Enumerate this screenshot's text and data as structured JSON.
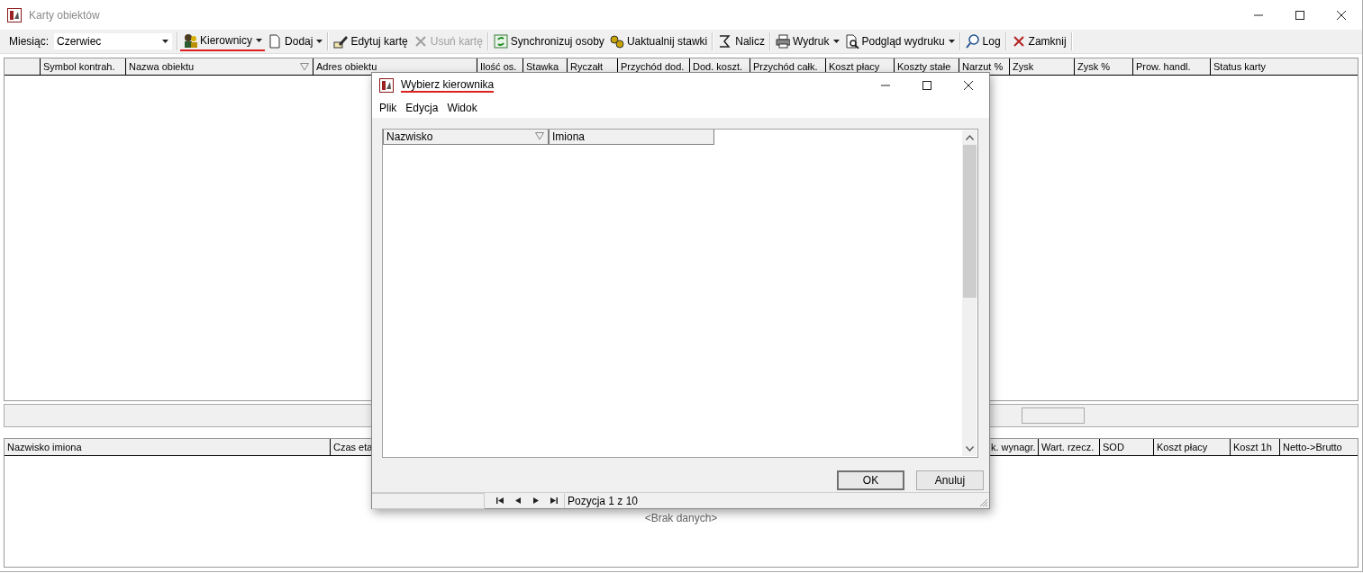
{
  "window": {
    "title": "Karty obiektów"
  },
  "toolbar": {
    "month_label": "Miesiąc:",
    "month_value": "Czerwiec",
    "buttons": [
      {
        "label": "Kierownicy",
        "dropdown": true,
        "disabled": false,
        "highlighted": true
      },
      {
        "label": "Dodaj",
        "dropdown": true,
        "disabled": false,
        "highlighted": false
      },
      {
        "label": "Edytuj kartę",
        "dropdown": false,
        "disabled": false,
        "highlighted": false
      },
      {
        "label": "Usuń kartę",
        "dropdown": false,
        "disabled": true,
        "highlighted": false
      },
      {
        "label": "Synchronizuj osoby",
        "dropdown": false,
        "disabled": false,
        "highlighted": false
      },
      {
        "label": "Uaktualnij stawki",
        "dropdown": false,
        "disabled": false,
        "highlighted": false
      },
      {
        "label": "Nalicz",
        "dropdown": false,
        "disabled": false,
        "highlighted": false
      },
      {
        "label": "Wydruk",
        "dropdown": true,
        "disabled": false,
        "highlighted": false
      },
      {
        "label": "Podgląd wydruku",
        "dropdown": true,
        "disabled": false,
        "highlighted": false
      },
      {
        "label": "Log",
        "dropdown": false,
        "disabled": false,
        "highlighted": false
      },
      {
        "label": "Zamknij",
        "dropdown": false,
        "disabled": false,
        "highlighted": false
      }
    ]
  },
  "objects_table": {
    "columns": [
      {
        "sorted": false
      },
      {
        "label": "Symbol kontrah.",
        "sorted": false
      },
      {
        "label": "Nazwa obiektu",
        "sorted": true
      },
      {
        "label": "Adres obiektu",
        "sorted": false
      },
      {
        "label": "Ilość os.",
        "sorted": false
      },
      {
        "label": "Stawka",
        "sorted": false
      },
      {
        "label": "Ryczałt",
        "sorted": false
      },
      {
        "label": "Przychód dod.",
        "sorted": false
      },
      {
        "label": "Dod. koszt.",
        "sorted": false
      },
      {
        "label": "Przychód całk.",
        "sorted": false
      },
      {
        "label": "Koszt płacy",
        "sorted": false
      },
      {
        "label": "Koszty stałe",
        "sorted": false
      },
      {
        "label": "Narzut %",
        "sorted": false
      },
      {
        "label": "Zysk",
        "sorted": false
      },
      {
        "label": "Zysk %",
        "sorted": false
      },
      {
        "label": "Prow. handl.",
        "sorted": false
      },
      {
        "label": "Status karty",
        "sorted": false
      }
    ]
  },
  "people_table": {
    "columns": [
      {
        "label": "Nazwisko imiona"
      },
      {
        "label": "Czas eta"
      },
      {},
      {
        "label": "k. wynagr."
      },
      {
        "label": "Wart. rzecz."
      },
      {
        "label": "SOD"
      },
      {
        "label": "Koszt płacy"
      },
      {
        "label": "Koszt 1h"
      },
      {
        "label": "Netto->Brutto"
      }
    ],
    "empty_text": "<Brak danych>"
  },
  "dialog": {
    "title": "Wybierz kierownika",
    "highlighted": true,
    "menu": [
      "Plik",
      "Edycja",
      "Widok"
    ],
    "columns": [
      {
        "label": "Nazwisko",
        "sorted": true
      },
      {
        "label": "Imiona",
        "sorted": false
      }
    ],
    "buttons": [
      "OK",
      "Anuluj"
    ],
    "position": "Pozycja 1 z 10"
  }
}
